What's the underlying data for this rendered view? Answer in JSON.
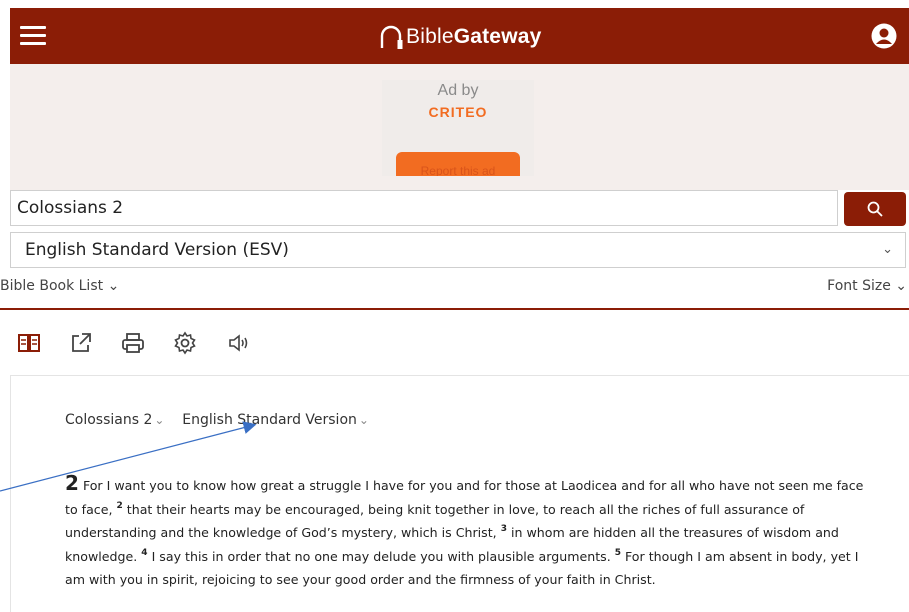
{
  "header": {
    "logo_text_light": "Bible",
    "logo_text_bold": "Gateway",
    "icons": [
      "menu-icon",
      "bible-gateway-logo-icon",
      "user-account-icon"
    ],
    "brand_color": "#8b1d06"
  },
  "ad": {
    "label": "Ad by",
    "brand": "CRITEO",
    "report_label": "Report this ad",
    "accent_color": "#f26c21"
  },
  "search": {
    "value": "Colossians 2",
    "button_icon": "search-icon"
  },
  "version_select": {
    "selected": "English Standard Version (ESV)"
  },
  "tools": {
    "book_list_label": "Bible Book List",
    "font_size_label": "Font Size",
    "icons": [
      "parallel-view-icon",
      "share-icon",
      "print-icon",
      "settings-icon",
      "audio-icon"
    ]
  },
  "passage": {
    "reference": "Colossians 2",
    "version": "English Standard Version",
    "chapter": "2",
    "verses": [
      {
        "num": "",
        "text": "For I want you to know how great a struggle I have for you and for those at Laodicea and for all who have not seen me face to face,"
      },
      {
        "num": "2",
        "text": "that their hearts may be encouraged, being knit together in love, to reach all the riches of full assurance of understanding and the knowledge of God’s mystery, which is Christ,"
      },
      {
        "num": "3",
        "text": "in whom are hidden all the treasures of wisdom and knowledge."
      },
      {
        "num": "4",
        "text": "I say this in order that no one may delude you with plausible arguments."
      },
      {
        "num": "5",
        "text": "For though I am absent in body, yet I am with you in spirit, rejoicing to see your good order and the firmness of your faith in Christ."
      }
    ]
  }
}
